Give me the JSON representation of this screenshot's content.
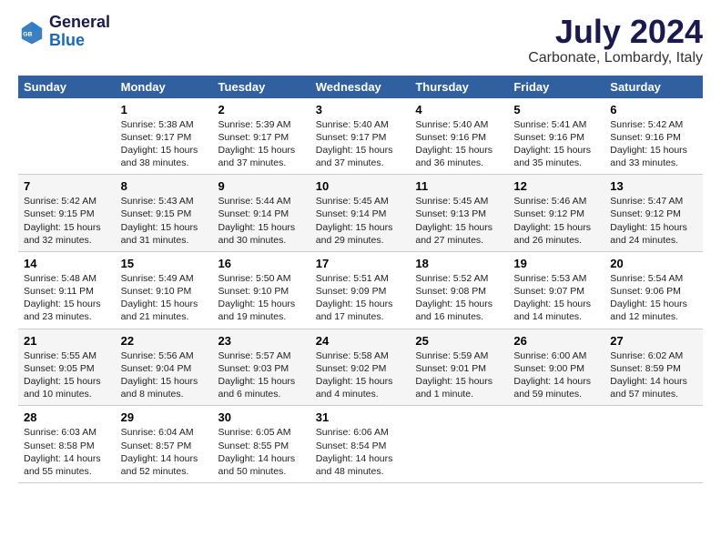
{
  "logo": {
    "line1": "General",
    "line2": "Blue"
  },
  "title": "July 2024",
  "location": "Carbonate, Lombardy, Italy",
  "columns": [
    "Sunday",
    "Monday",
    "Tuesday",
    "Wednesday",
    "Thursday",
    "Friday",
    "Saturday"
  ],
  "weeks": [
    [
      {
        "day": "",
        "text": ""
      },
      {
        "day": "1",
        "text": "Sunrise: 5:38 AM\nSunset: 9:17 PM\nDaylight: 15 hours\nand 38 minutes."
      },
      {
        "day": "2",
        "text": "Sunrise: 5:39 AM\nSunset: 9:17 PM\nDaylight: 15 hours\nand 37 minutes."
      },
      {
        "day": "3",
        "text": "Sunrise: 5:40 AM\nSunset: 9:17 PM\nDaylight: 15 hours\nand 37 minutes."
      },
      {
        "day": "4",
        "text": "Sunrise: 5:40 AM\nSunset: 9:16 PM\nDaylight: 15 hours\nand 36 minutes."
      },
      {
        "day": "5",
        "text": "Sunrise: 5:41 AM\nSunset: 9:16 PM\nDaylight: 15 hours\nand 35 minutes."
      },
      {
        "day": "6",
        "text": "Sunrise: 5:42 AM\nSunset: 9:16 PM\nDaylight: 15 hours\nand 33 minutes."
      }
    ],
    [
      {
        "day": "7",
        "text": "Sunrise: 5:42 AM\nSunset: 9:15 PM\nDaylight: 15 hours\nand 32 minutes."
      },
      {
        "day": "8",
        "text": "Sunrise: 5:43 AM\nSunset: 9:15 PM\nDaylight: 15 hours\nand 31 minutes."
      },
      {
        "day": "9",
        "text": "Sunrise: 5:44 AM\nSunset: 9:14 PM\nDaylight: 15 hours\nand 30 minutes."
      },
      {
        "day": "10",
        "text": "Sunrise: 5:45 AM\nSunset: 9:14 PM\nDaylight: 15 hours\nand 29 minutes."
      },
      {
        "day": "11",
        "text": "Sunrise: 5:45 AM\nSunset: 9:13 PM\nDaylight: 15 hours\nand 27 minutes."
      },
      {
        "day": "12",
        "text": "Sunrise: 5:46 AM\nSunset: 9:12 PM\nDaylight: 15 hours\nand 26 minutes."
      },
      {
        "day": "13",
        "text": "Sunrise: 5:47 AM\nSunset: 9:12 PM\nDaylight: 15 hours\nand 24 minutes."
      }
    ],
    [
      {
        "day": "14",
        "text": "Sunrise: 5:48 AM\nSunset: 9:11 PM\nDaylight: 15 hours\nand 23 minutes."
      },
      {
        "day": "15",
        "text": "Sunrise: 5:49 AM\nSunset: 9:10 PM\nDaylight: 15 hours\nand 21 minutes."
      },
      {
        "day": "16",
        "text": "Sunrise: 5:50 AM\nSunset: 9:10 PM\nDaylight: 15 hours\nand 19 minutes."
      },
      {
        "day": "17",
        "text": "Sunrise: 5:51 AM\nSunset: 9:09 PM\nDaylight: 15 hours\nand 17 minutes."
      },
      {
        "day": "18",
        "text": "Sunrise: 5:52 AM\nSunset: 9:08 PM\nDaylight: 15 hours\nand 16 minutes."
      },
      {
        "day": "19",
        "text": "Sunrise: 5:53 AM\nSunset: 9:07 PM\nDaylight: 15 hours\nand 14 minutes."
      },
      {
        "day": "20",
        "text": "Sunrise: 5:54 AM\nSunset: 9:06 PM\nDaylight: 15 hours\nand 12 minutes."
      }
    ],
    [
      {
        "day": "21",
        "text": "Sunrise: 5:55 AM\nSunset: 9:05 PM\nDaylight: 15 hours\nand 10 minutes."
      },
      {
        "day": "22",
        "text": "Sunrise: 5:56 AM\nSunset: 9:04 PM\nDaylight: 15 hours\nand 8 minutes."
      },
      {
        "day": "23",
        "text": "Sunrise: 5:57 AM\nSunset: 9:03 PM\nDaylight: 15 hours\nand 6 minutes."
      },
      {
        "day": "24",
        "text": "Sunrise: 5:58 AM\nSunset: 9:02 PM\nDaylight: 15 hours\nand 4 minutes."
      },
      {
        "day": "25",
        "text": "Sunrise: 5:59 AM\nSunset: 9:01 PM\nDaylight: 15 hours\nand 1 minute."
      },
      {
        "day": "26",
        "text": "Sunrise: 6:00 AM\nSunset: 9:00 PM\nDaylight: 14 hours\nand 59 minutes."
      },
      {
        "day": "27",
        "text": "Sunrise: 6:02 AM\nSunset: 8:59 PM\nDaylight: 14 hours\nand 57 minutes."
      }
    ],
    [
      {
        "day": "28",
        "text": "Sunrise: 6:03 AM\nSunset: 8:58 PM\nDaylight: 14 hours\nand 55 minutes."
      },
      {
        "day": "29",
        "text": "Sunrise: 6:04 AM\nSunset: 8:57 PM\nDaylight: 14 hours\nand 52 minutes."
      },
      {
        "day": "30",
        "text": "Sunrise: 6:05 AM\nSunset: 8:55 PM\nDaylight: 14 hours\nand 50 minutes."
      },
      {
        "day": "31",
        "text": "Sunrise: 6:06 AM\nSunset: 8:54 PM\nDaylight: 14 hours\nand 48 minutes."
      },
      {
        "day": "",
        "text": ""
      },
      {
        "day": "",
        "text": ""
      },
      {
        "day": "",
        "text": ""
      }
    ]
  ]
}
